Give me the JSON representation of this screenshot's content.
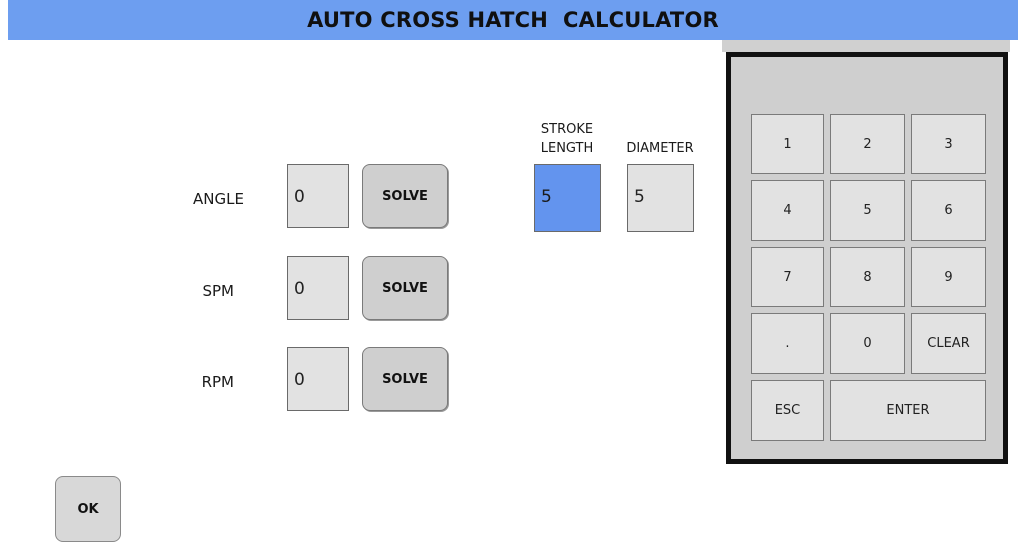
{
  "title": "AUTO CROSS HATCH  CALCULATOR",
  "rows": {
    "angle": {
      "label": "ANGLE",
      "value": "0",
      "solve": "SOLVE"
    },
    "spm": {
      "label": "SPM",
      "value": "0",
      "solve": "SOLVE"
    },
    "rpm": {
      "label": "RPM",
      "value": "0",
      "solve": "SOLVE"
    }
  },
  "stroke": {
    "header_line1": "STROKE",
    "header_line2": "LENGTH",
    "value": "5"
  },
  "diameter": {
    "header": "DIAMETER",
    "value": "5"
  },
  "ok_label": "OK",
  "keypad": {
    "k1": "1",
    "k2": "2",
    "k3": "3",
    "k4": "4",
    "k5": "5",
    "k6": "6",
    "k7": "7",
    "k8": "8",
    "k9": "9",
    "kdot": ".",
    "k0": "0",
    "clear": "CLEAR",
    "esc": "ESC",
    "enter": "ENTER"
  },
  "colors": {
    "title_bar": "#6d9ef0",
    "active_field": "#6394ee"
  }
}
